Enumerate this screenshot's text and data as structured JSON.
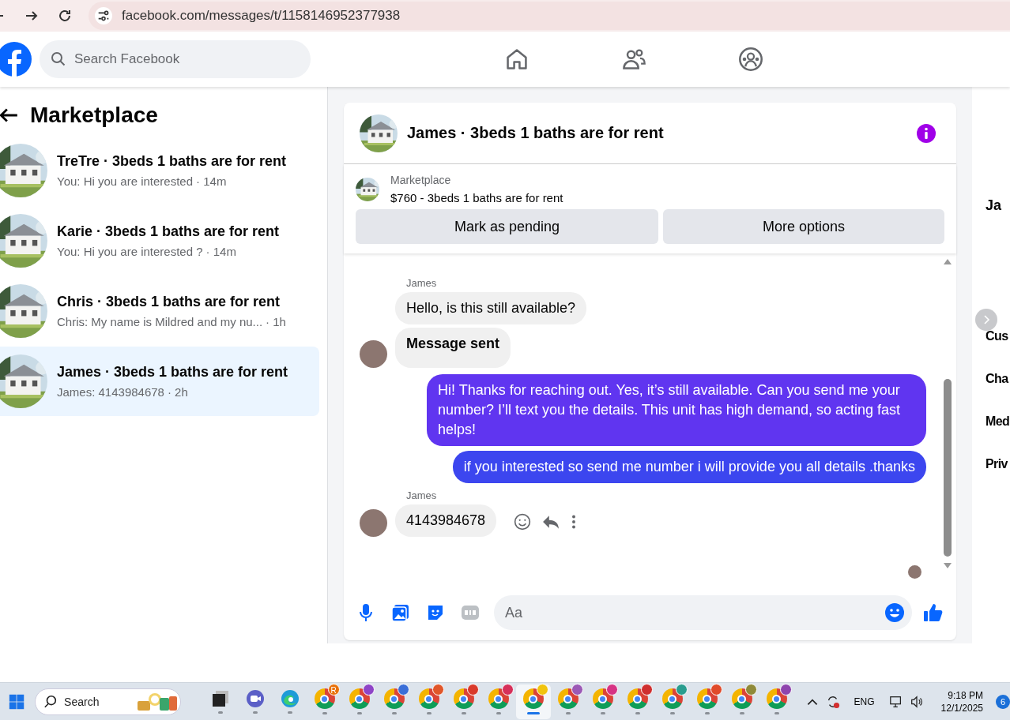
{
  "browser": {
    "url": "facebook.com/messages/t/1158146952377938"
  },
  "header": {
    "search": {
      "placeholder": "Search Facebook"
    }
  },
  "sidebar": {
    "title": "Marketplace",
    "conversations": [
      {
        "title": "TreTre · 3beds 1 baths are for rent",
        "preview": "You: Hi you are interested",
        "time": "· 14m",
        "selected": false
      },
      {
        "title": "Karie · 3beds 1 baths are for rent",
        "preview": "You: Hi you are interested ?",
        "time": "· 14m",
        "selected": false
      },
      {
        "title": "Chris · 3beds 1 baths are for rent",
        "preview": "Chris: My name is Mildred and my nu...",
        "time": "· 1h",
        "selected": false
      },
      {
        "title": "James · 3beds 1 baths are for rent",
        "preview": "James: 4143984678",
        "time": "· 2h",
        "selected": true
      }
    ]
  },
  "chat": {
    "title": "James · 3beds 1 baths are for rent",
    "listing": {
      "source": "Marketplace",
      "title": "$760 - 3beds 1 baths are for rent"
    },
    "actions": [
      "Mark as pending",
      "More options"
    ],
    "messages": [
      {
        "kind": "incoming",
        "sender": "James",
        "text": "Hello, is this still available?",
        "bold": false,
        "avatar": false,
        "hover_actions": false
      },
      {
        "kind": "incoming",
        "text": "Message sent",
        "bold": true,
        "avatar": true,
        "hover_actions": false
      },
      {
        "kind": "outgoing",
        "text": "Hi! Thanks for reaching out. Yes, it’s still available. Can you send me your number? I’ll text you the details. This unit has high demand, so acting fast helps!",
        "bold": false
      },
      {
        "kind": "outgoing",
        "text": "if you interested so send me number i will provide you all details .thanks",
        "bold": false
      },
      {
        "kind": "incoming",
        "sender": "James",
        "text": "4143984678",
        "bold": false,
        "avatar": true,
        "hover_actions": true
      }
    ],
    "composer": {
      "placeholder": "Aa"
    }
  },
  "details_panel": {
    "name": "Ja",
    "items": [
      "Cus",
      "Cha",
      "Med",
      "Priv"
    ]
  },
  "taskbar": {
    "search": "Search",
    "apps": [
      {
        "kind": "files",
        "selected": false
      },
      {
        "kind": "meet",
        "selected": false
      },
      {
        "kind": "edge",
        "selected": false
      },
      {
        "kind": "chrome",
        "color": "#e8710a",
        "badge_text": "R",
        "selected": false
      },
      {
        "kind": "chrome",
        "color": "#8e44c7",
        "selected": false
      },
      {
        "kind": "chrome",
        "color": "#3b6fd8",
        "selected": false
      },
      {
        "kind": "chrome",
        "color": "#e0562a",
        "selected": false
      },
      {
        "kind": "chrome",
        "color": "#d93a2b",
        "selected": false
      },
      {
        "kind": "chrome",
        "color": "#d6305a",
        "selected": false
      },
      {
        "kind": "chrome",
        "color": "#f1c40f",
        "selected": true
      },
      {
        "kind": "chrome",
        "color": "#9b59b6",
        "selected": false
      },
      {
        "kind": "chrome",
        "color": "#d63384",
        "selected": false
      },
      {
        "kind": "chrome",
        "color": "#cf2f2f",
        "selected": false
      },
      {
        "kind": "chrome",
        "color": "#2a9d8f",
        "selected": false
      },
      {
        "kind": "chrome",
        "color": "#e04a2a",
        "selected": false
      },
      {
        "kind": "chrome",
        "color": "#8f8a3a",
        "selected": false
      },
      {
        "kind": "chrome",
        "color": "#8e44ad",
        "selected": false
      }
    ],
    "language": "ENG",
    "time": "9:18 PM",
    "date": "12/1/2025",
    "notifications": "6"
  }
}
